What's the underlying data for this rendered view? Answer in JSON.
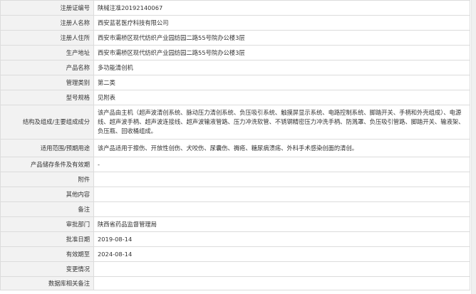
{
  "rows": [
    {
      "label": "注册证编号",
      "value": "陕械注准20192140067"
    },
    {
      "label": "注册人名称",
      "value": "西安蓝茗医疗科技有限公司"
    },
    {
      "label": "注册人住所",
      "value": "西安市灞桥区现代纺织产业园纺园二路55号院办公楼3层"
    },
    {
      "label": "生产地址",
      "value": "西安市灞桥区现代纺织产业园纺园二路55号院办公楼3层"
    },
    {
      "label": "产品名称",
      "value": "多功能清创机"
    },
    {
      "label": "管理类别",
      "value": "第二类"
    },
    {
      "label": "型号规格",
      "value": "见附表"
    },
    {
      "label": "结构及组成/主要组成成分",
      "value": "该产品由主机（超声波清创系统、脉动压力清创系统、负压吸引系统、触摸屏显示系统、电路控制系统、脚踏开关、手柄和外壳组成）、电源线、超声波手柄、超声波连接线、超声波输液管路、压力冲洗软管、不锈钢精密压力冲洗手柄、防溅罩、负压吸引管路、脚踏开关、输液架、负压瓶、回收桶组成。"
    },
    {
      "label": "适用范围/预期用途",
      "value": "该产品适用于擦伤、开放性创伤、犬咬伤、尿囊伤、褥疮、糖尿病溃疡、外科手术感染创面的清创。"
    },
    {
      "label": "产品储存条件及有效期",
      "value": "-"
    },
    {
      "label": "附件",
      "value": ""
    },
    {
      "label": "其他内容",
      "value": ""
    },
    {
      "label": "备注",
      "value": ""
    },
    {
      "label": "审批部门",
      "value": "陕西省药品监督管理局"
    },
    {
      "label": "批准日期",
      "value": "2019-08-14"
    },
    {
      "label": "有效期至",
      "value": "2024-08-14"
    },
    {
      "label": "变更情况",
      "value": ""
    },
    {
      "label": "数据库相关备注",
      "value": ""
    }
  ]
}
